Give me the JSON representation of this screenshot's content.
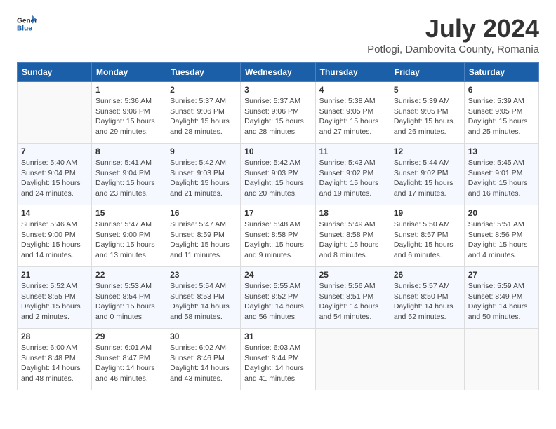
{
  "header": {
    "logo_general": "General",
    "logo_blue": "Blue",
    "title": "July 2024",
    "subtitle": "Potlogi, Dambovita County, Romania"
  },
  "days_of_week": [
    "Sunday",
    "Monday",
    "Tuesday",
    "Wednesday",
    "Thursday",
    "Friday",
    "Saturday"
  ],
  "weeks": [
    [
      {
        "num": "",
        "info": ""
      },
      {
        "num": "1",
        "info": "Sunrise: 5:36 AM\nSunset: 9:06 PM\nDaylight: 15 hours\nand 29 minutes."
      },
      {
        "num": "2",
        "info": "Sunrise: 5:37 AM\nSunset: 9:06 PM\nDaylight: 15 hours\nand 28 minutes."
      },
      {
        "num": "3",
        "info": "Sunrise: 5:37 AM\nSunset: 9:06 PM\nDaylight: 15 hours\nand 28 minutes."
      },
      {
        "num": "4",
        "info": "Sunrise: 5:38 AM\nSunset: 9:05 PM\nDaylight: 15 hours\nand 27 minutes."
      },
      {
        "num": "5",
        "info": "Sunrise: 5:39 AM\nSunset: 9:05 PM\nDaylight: 15 hours\nand 26 minutes."
      },
      {
        "num": "6",
        "info": "Sunrise: 5:39 AM\nSunset: 9:05 PM\nDaylight: 15 hours\nand 25 minutes."
      }
    ],
    [
      {
        "num": "7",
        "info": "Sunrise: 5:40 AM\nSunset: 9:04 PM\nDaylight: 15 hours\nand 24 minutes."
      },
      {
        "num": "8",
        "info": "Sunrise: 5:41 AM\nSunset: 9:04 PM\nDaylight: 15 hours\nand 23 minutes."
      },
      {
        "num": "9",
        "info": "Sunrise: 5:42 AM\nSunset: 9:03 PM\nDaylight: 15 hours\nand 21 minutes."
      },
      {
        "num": "10",
        "info": "Sunrise: 5:42 AM\nSunset: 9:03 PM\nDaylight: 15 hours\nand 20 minutes."
      },
      {
        "num": "11",
        "info": "Sunrise: 5:43 AM\nSunset: 9:02 PM\nDaylight: 15 hours\nand 19 minutes."
      },
      {
        "num": "12",
        "info": "Sunrise: 5:44 AM\nSunset: 9:02 PM\nDaylight: 15 hours\nand 17 minutes."
      },
      {
        "num": "13",
        "info": "Sunrise: 5:45 AM\nSunset: 9:01 PM\nDaylight: 15 hours\nand 16 minutes."
      }
    ],
    [
      {
        "num": "14",
        "info": "Sunrise: 5:46 AM\nSunset: 9:00 PM\nDaylight: 15 hours\nand 14 minutes."
      },
      {
        "num": "15",
        "info": "Sunrise: 5:47 AM\nSunset: 9:00 PM\nDaylight: 15 hours\nand 13 minutes."
      },
      {
        "num": "16",
        "info": "Sunrise: 5:47 AM\nSunset: 8:59 PM\nDaylight: 15 hours\nand 11 minutes."
      },
      {
        "num": "17",
        "info": "Sunrise: 5:48 AM\nSunset: 8:58 PM\nDaylight: 15 hours\nand 9 minutes."
      },
      {
        "num": "18",
        "info": "Sunrise: 5:49 AM\nSunset: 8:58 PM\nDaylight: 15 hours\nand 8 minutes."
      },
      {
        "num": "19",
        "info": "Sunrise: 5:50 AM\nSunset: 8:57 PM\nDaylight: 15 hours\nand 6 minutes."
      },
      {
        "num": "20",
        "info": "Sunrise: 5:51 AM\nSunset: 8:56 PM\nDaylight: 15 hours\nand 4 minutes."
      }
    ],
    [
      {
        "num": "21",
        "info": "Sunrise: 5:52 AM\nSunset: 8:55 PM\nDaylight: 15 hours\nand 2 minutes."
      },
      {
        "num": "22",
        "info": "Sunrise: 5:53 AM\nSunset: 8:54 PM\nDaylight: 15 hours\nand 0 minutes."
      },
      {
        "num": "23",
        "info": "Sunrise: 5:54 AM\nSunset: 8:53 PM\nDaylight: 14 hours\nand 58 minutes."
      },
      {
        "num": "24",
        "info": "Sunrise: 5:55 AM\nSunset: 8:52 PM\nDaylight: 14 hours\nand 56 minutes."
      },
      {
        "num": "25",
        "info": "Sunrise: 5:56 AM\nSunset: 8:51 PM\nDaylight: 14 hours\nand 54 minutes."
      },
      {
        "num": "26",
        "info": "Sunrise: 5:57 AM\nSunset: 8:50 PM\nDaylight: 14 hours\nand 52 minutes."
      },
      {
        "num": "27",
        "info": "Sunrise: 5:59 AM\nSunset: 8:49 PM\nDaylight: 14 hours\nand 50 minutes."
      }
    ],
    [
      {
        "num": "28",
        "info": "Sunrise: 6:00 AM\nSunset: 8:48 PM\nDaylight: 14 hours\nand 48 minutes."
      },
      {
        "num": "29",
        "info": "Sunrise: 6:01 AM\nSunset: 8:47 PM\nDaylight: 14 hours\nand 46 minutes."
      },
      {
        "num": "30",
        "info": "Sunrise: 6:02 AM\nSunset: 8:46 PM\nDaylight: 14 hours\nand 43 minutes."
      },
      {
        "num": "31",
        "info": "Sunrise: 6:03 AM\nSunset: 8:44 PM\nDaylight: 14 hours\nand 41 minutes."
      },
      {
        "num": "",
        "info": ""
      },
      {
        "num": "",
        "info": ""
      },
      {
        "num": "",
        "info": ""
      }
    ]
  ]
}
